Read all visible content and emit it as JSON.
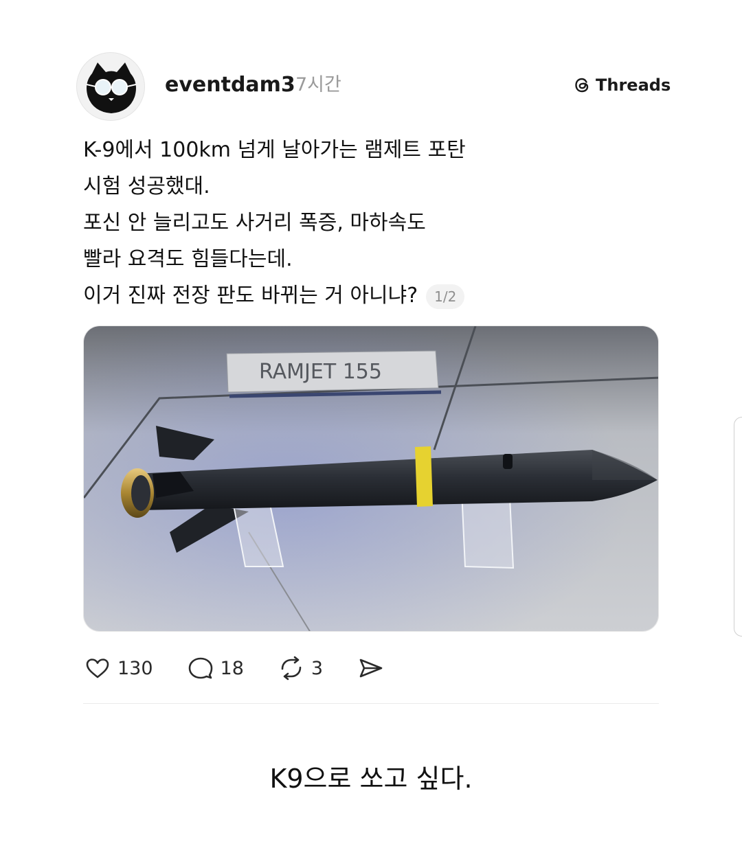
{
  "post": {
    "username": "eventdam3",
    "timestamp": "7시간",
    "platform_label": "Threads",
    "lines": [
      "K-9에서 100km 넘게 날아가는 램제트 포탄",
      "시험 성공했대.",
      "포신 안 늘리고도 사거리 폭증, 마하속도",
      "빨라 요격도 힘들다는데.",
      "이거 진짜 전장 판도 바뀌는 거 아니냐?"
    ],
    "page_indicator": "1/2",
    "image": {
      "sign_text": "RAMJET 155"
    },
    "actions": {
      "like_count": "130",
      "comment_count": "18",
      "repost_count": "3"
    }
  },
  "caption": "K9으로 쏘고 싶다.",
  "icons": {
    "avatar": "cat-with-glasses-icon",
    "platform": "threads-logo-icon",
    "like": "heart-icon",
    "comment": "comment-bubble-icon",
    "repost": "repost-icon",
    "share": "send-icon"
  }
}
